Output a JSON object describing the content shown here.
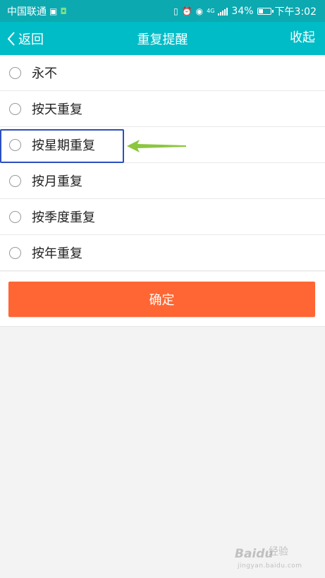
{
  "status_bar": {
    "carrier": "中国联通",
    "battery": "34%",
    "time": "下午3:02",
    "network": "4G"
  },
  "nav": {
    "back_label": "返回",
    "title": "重复提醒",
    "collapse_label": "收起"
  },
  "options": [
    {
      "label": "永不"
    },
    {
      "label": "按天重复"
    },
    {
      "label": "按星期重复"
    },
    {
      "label": "按月重复"
    },
    {
      "label": "按季度重复"
    },
    {
      "label": "按年重复"
    }
  ],
  "confirm": {
    "label": "确定"
  },
  "watermark": {
    "brand": "Baidu",
    "sub": "经验",
    "url": "jingyan.baidu.com"
  },
  "colors": {
    "status_bar": "#0ca9b1",
    "nav_bar": "#00bcc7",
    "confirm_button": "#ff6633",
    "highlight_border": "#2a4fbe",
    "arrow": "#8cc63f"
  }
}
